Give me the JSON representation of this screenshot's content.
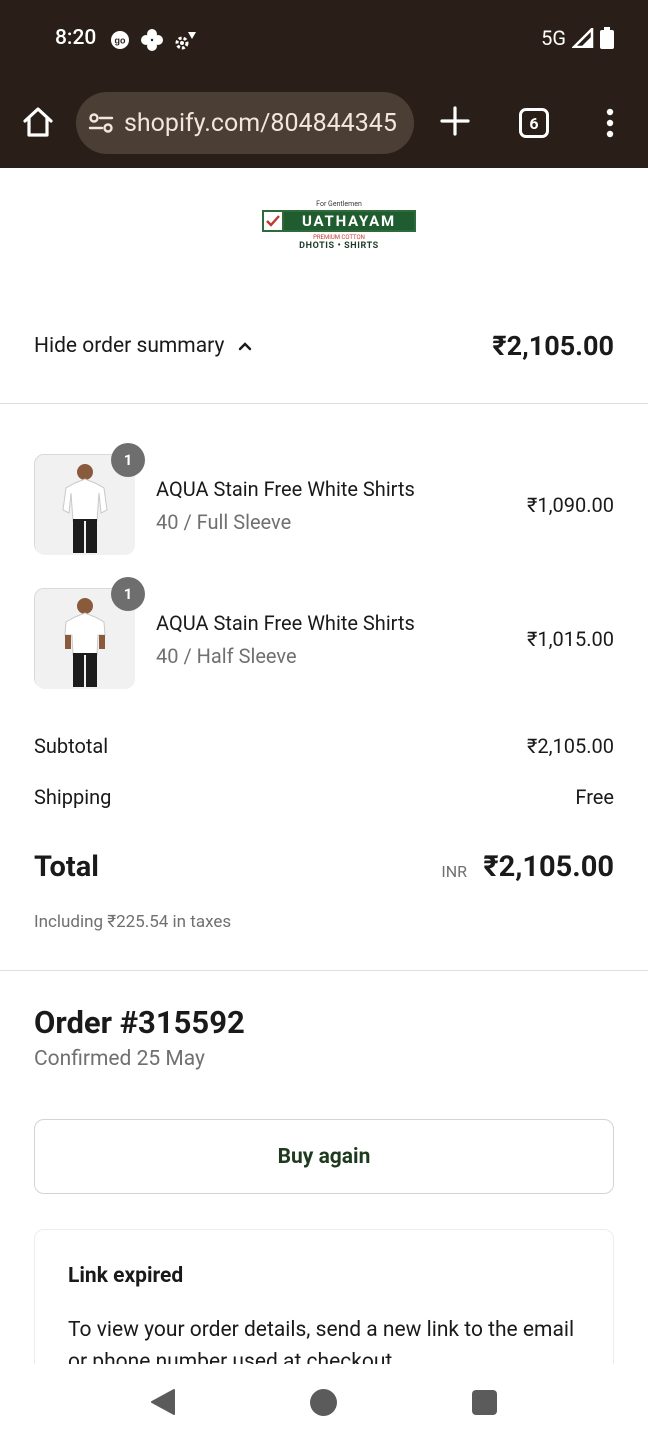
{
  "status_bar": {
    "time": "8:20",
    "network": "5G",
    "left_icons": [
      "go-icon",
      "shield-plus-icon",
      "settings-gear-icon"
    ],
    "right_icons": [
      "signal-icon",
      "battery-icon"
    ]
  },
  "browser": {
    "url": "shopify.com/804844345",
    "tab_count": "6",
    "icons": [
      "home-icon",
      "site-settings-icon",
      "new-tab-plus-icon",
      "tabs-icon",
      "menu-dots-icon"
    ]
  },
  "store": {
    "logo_tagline": "For Gentlemen",
    "logo_name": "UATHAYAM",
    "logo_sub1": "PREMIUM COTTON",
    "logo_sub2": "DHOTIS • SHIRTS"
  },
  "summary": {
    "toggle_label": "Hide order summary",
    "total": "₹2,105.00"
  },
  "items": [
    {
      "quantity": "1",
      "title": "AQUA Stain Free White Shirts",
      "variant": "40 / Full Sleeve",
      "price": "₹1,090.00"
    },
    {
      "quantity": "1",
      "title": "AQUA Stain Free White Shirts",
      "variant": "40 / Half Sleeve",
      "price": "₹1,015.00"
    }
  ],
  "totals": {
    "subtotal_label": "Subtotal",
    "subtotal_value": "₹2,105.00",
    "shipping_label": "Shipping",
    "shipping_value": "Free",
    "total_label": "Total",
    "currency": "INR",
    "total_value": "₹2,105.00",
    "tax_note": "Including ₹225.54 in taxes"
  },
  "order": {
    "title": "Order #315592",
    "confirmed": "Confirmed 25 May",
    "buy_again_label": "Buy again"
  },
  "notice": {
    "title": "Link expired",
    "text": "To view your order details, send a new link to the email or phone number used at checkout."
  },
  "colors": {
    "chrome_bg": "#2a1f18",
    "address_bar_bg": "#4a3e35",
    "brand_green": "#1f5c2f",
    "button_text": "#1f3b1f"
  }
}
